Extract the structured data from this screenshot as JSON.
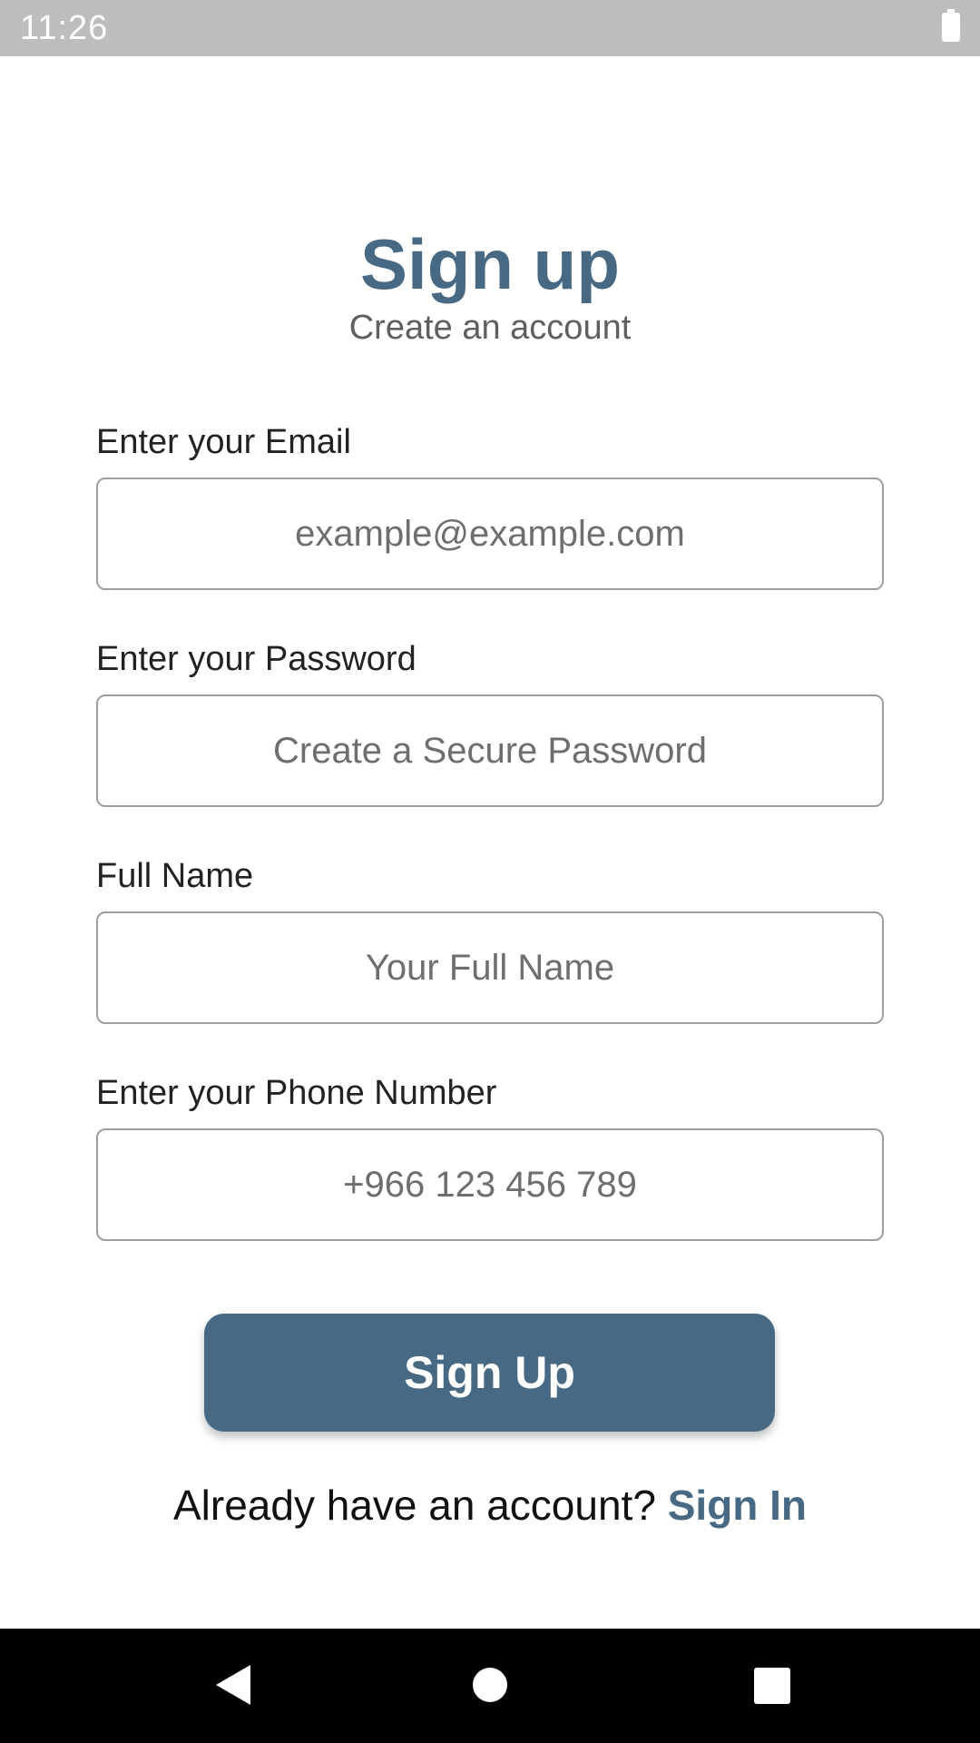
{
  "status_bar": {
    "time": "11:26",
    "battery_icon": "battery-full-icon"
  },
  "header": {
    "title": "Sign up",
    "subtitle": "Create an account"
  },
  "form": {
    "email": {
      "label": "Enter your Email",
      "placeholder": "example@example.com",
      "value": ""
    },
    "password": {
      "label": "Enter your Password",
      "placeholder": "Create a Secure Password",
      "value": ""
    },
    "full_name": {
      "label": "Full Name",
      "placeholder": "Your Full Name",
      "value": ""
    },
    "phone": {
      "label": "Enter your Phone Number",
      "placeholder": "+966 123 456 789",
      "value": ""
    }
  },
  "actions": {
    "signup_label": "Sign Up",
    "signin_prompt": "Already have an account? ",
    "signin_link": "Sign In"
  },
  "nav_bar": {
    "back_icon": "back-triangle-icon",
    "home_icon": "home-circle-icon",
    "recents_icon": "recents-square-icon"
  },
  "colors": {
    "accent": "#476984",
    "status_bar": "#bdbdbd",
    "nav_bar": "#000000"
  }
}
